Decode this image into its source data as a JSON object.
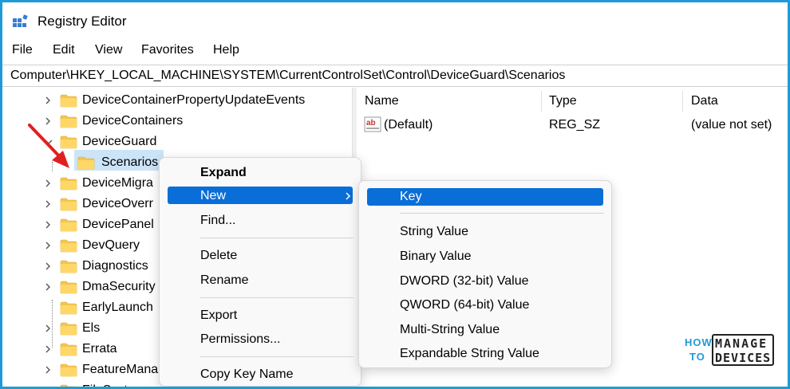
{
  "window": {
    "title": "Registry Editor"
  },
  "menu": {
    "file": "File",
    "edit": "Edit",
    "view": "View",
    "favorites": "Favorites",
    "help": "Help"
  },
  "address": "Computer\\HKEY_LOCAL_MACHINE\\SYSTEM\\CurrentControlSet\\Control\\DeviceGuard\\Scenarios",
  "tree": {
    "items": [
      "DeviceContainerPropertyUpdateEvents",
      "DeviceContainers",
      "DeviceGuard",
      "Scenarios",
      "DeviceMigra",
      "DeviceOverr",
      "DevicePanel",
      "DevQuery",
      "Diagnostics",
      "DmaSecurity",
      "EarlyLaunch",
      "Els",
      "Errata",
      "FeatureMana",
      "FileSystem"
    ]
  },
  "list": {
    "columns": {
      "name": "Name",
      "type": "Type",
      "data": "Data"
    },
    "rows": [
      {
        "name": "(Default)",
        "type": "REG_SZ",
        "data": "(value not set)"
      }
    ]
  },
  "context_menu": {
    "expand": "Expand",
    "new": "New",
    "find": "Find...",
    "delete": "Delete",
    "rename": "Rename",
    "export": "Export",
    "permissions": "Permissions...",
    "copy_key_name": "Copy Key Name"
  },
  "submenu": {
    "key": "Key",
    "string_value": "String Value",
    "binary_value": "Binary Value",
    "dword": "DWORD (32-bit) Value",
    "qword": "QWORD (64-bit) Value",
    "multi_string": "Multi-String Value",
    "expandable_string": "Expandable String Value"
  },
  "logo": {
    "how": "HOW",
    "to": "TO",
    "manage": "MANAGE",
    "devices": "DEVICES"
  },
  "colors": {
    "accent": "#0a6ed8",
    "selection": "#cce4f7",
    "folder": "#f5c64d",
    "frame": "#1e9bd7",
    "arrow": "#e02020"
  }
}
